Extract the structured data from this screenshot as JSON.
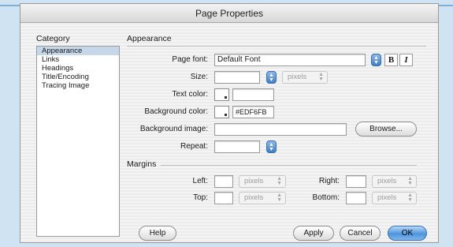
{
  "window": {
    "title": "Page Properties"
  },
  "category": {
    "heading": "Category",
    "items": [
      "Appearance",
      "Links",
      "Headings",
      "Title/Encoding",
      "Tracing Image"
    ],
    "selected_index": 0
  },
  "appearance": {
    "heading": "Appearance",
    "page_font_label": "Page font:",
    "page_font_value": "Default Font",
    "bold_label": "B",
    "italic_label": "I",
    "size_label": "Size:",
    "size_value": "",
    "size_unit": "pixels",
    "text_color_label": "Text color:",
    "text_color_value": "",
    "bg_color_label": "Background color:",
    "bg_color_value": "#EDF6FB",
    "bg_image_label": "Background image:",
    "bg_image_value": "",
    "browse_label": "Browse...",
    "repeat_label": "Repeat:",
    "repeat_value": ""
  },
  "margins": {
    "heading": "Margins",
    "left_label": "Left:",
    "right_label": "Right:",
    "top_label": "Top:",
    "bottom_label": "Bottom:",
    "unit": "pixels",
    "left_value": "",
    "right_value": "",
    "top_value": "",
    "bottom_value": ""
  },
  "buttons": {
    "help": "Help",
    "apply": "Apply",
    "cancel": "Cancel",
    "ok": "OK"
  },
  "icons": {
    "stepper": "up-down-stepper-icon",
    "color_swatch": "color-swatch-icon"
  },
  "colors": {
    "accent": "#4c95dd",
    "selection": "#c6d7ea",
    "backdrop": "#cfe3f2"
  }
}
